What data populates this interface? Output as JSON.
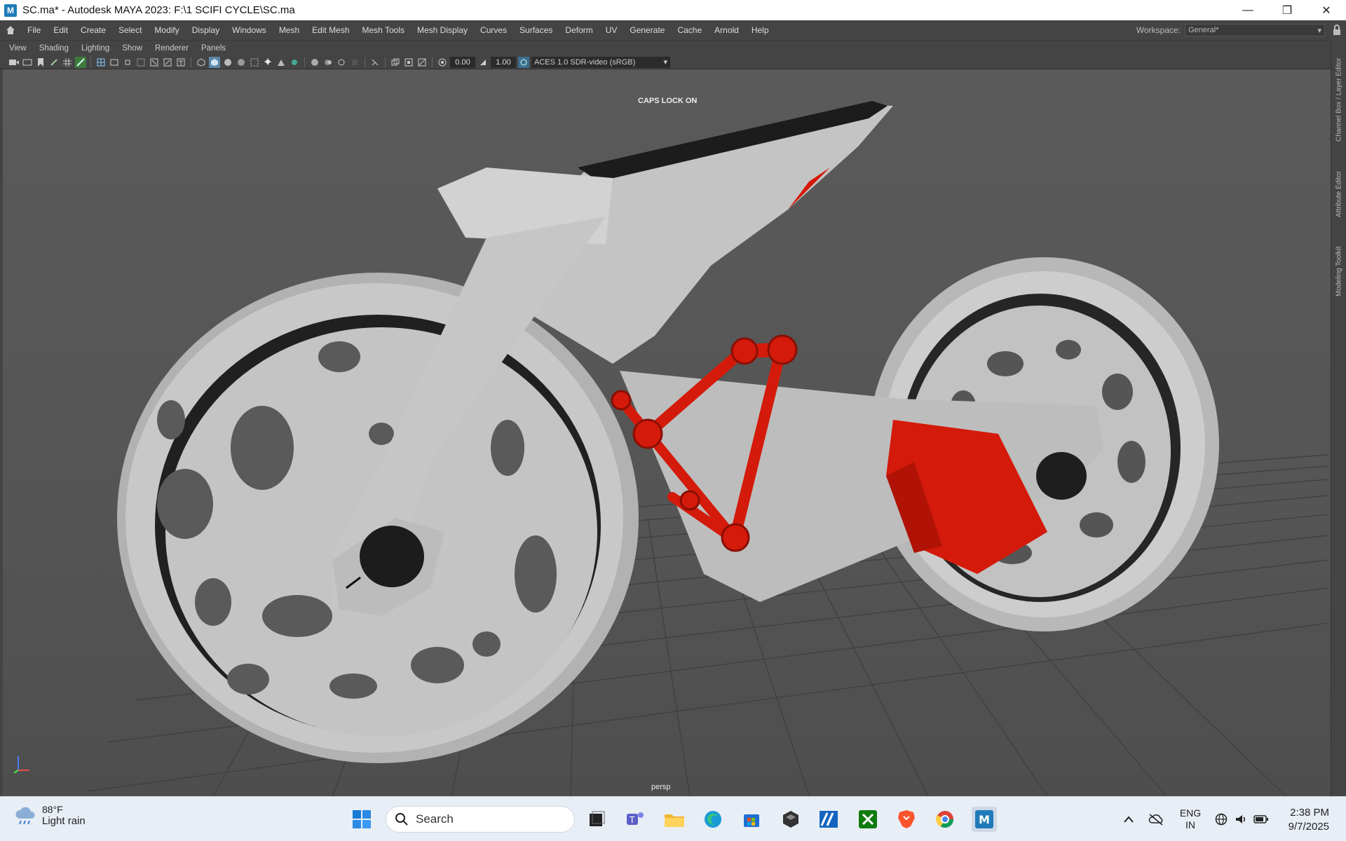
{
  "window": {
    "title": "SC.ma* - Autodesk MAYA 2023: F:\\1 SCIFI CYCLE\\SC.ma",
    "app_icon_letter": "M",
    "minimize": "—",
    "restore": "❐",
    "close": "✕"
  },
  "menubar": {
    "items": [
      "File",
      "Edit",
      "Create",
      "Select",
      "Modify",
      "Display",
      "Windows",
      "Mesh",
      "Edit Mesh",
      "Mesh Tools",
      "Mesh Display",
      "Curves",
      "Surfaces",
      "Deform",
      "UV",
      "Generate",
      "Cache",
      "Arnold",
      "Help"
    ],
    "workspace_label": "Workspace:",
    "workspace_value": "General*"
  },
  "panel_menu": {
    "items": [
      "View",
      "Shading",
      "Lighting",
      "Show",
      "Renderer",
      "Panels"
    ]
  },
  "toolbar": {
    "exposure": "0.00",
    "gamma": "1.00",
    "color_space": "ACES 1.0 SDR-video (sRGB)"
  },
  "viewport": {
    "caps_lock": "CAPS LOCK ON",
    "camera": "persp"
  },
  "side_tabs": [
    "Channel Box / Layer Editor",
    "Attribute Editor",
    "Modeling Toolkit"
  ],
  "taskbar": {
    "temperature": "88°F",
    "condition": "Light rain",
    "search_placeholder": "Search",
    "language": "ENG",
    "region": "IN",
    "time": "2:38 PM",
    "date": "9/7/2025"
  },
  "colors": {
    "maya_bg": "#444444",
    "frame_red": "#d41a0a",
    "wheel_grey": "#bdbdbd"
  }
}
